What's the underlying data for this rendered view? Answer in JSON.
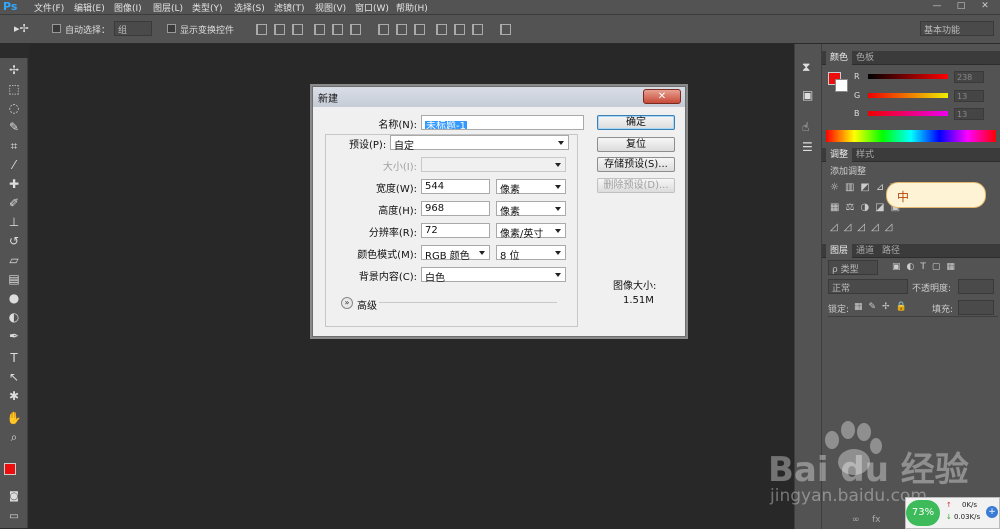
{
  "app": {
    "logo": "Ps"
  },
  "menu": [
    "文件(F)",
    "编辑(E)",
    "图像(I)",
    "图层(L)",
    "类型(Y)",
    "选择(S)",
    "滤镜(T)",
    "视图(V)",
    "窗口(W)",
    "帮助(H)"
  ],
  "window_controls": [
    "—",
    "□",
    "✕"
  ],
  "options": {
    "auto_select_label": "自动选择：",
    "auto_select_value": "组",
    "show_transform_label": "显示变换控件",
    "workspace": "基本功能"
  },
  "panels": {
    "color_tabs": [
      "颜色",
      "色板"
    ],
    "rgb": [
      {
        "label": "R",
        "value": "238"
      },
      {
        "label": "G",
        "value": "13"
      },
      {
        "label": "B",
        "value": "13"
      }
    ],
    "adjust_tabs": [
      "调整",
      "样式"
    ],
    "add_adjustment": "添加调整",
    "layers_tabs": [
      "图层",
      "通道",
      "路径"
    ],
    "layer_kind": "ρ 类型",
    "blend_mode": "正常",
    "opacity_label": "不透明度:",
    "lock_label": "锁定:",
    "fill_label": "填充:",
    "fx_icon": "fx",
    "ime_text": "中"
  },
  "dialog": {
    "title": "新建",
    "close": "✕",
    "name_label": "名称(N):",
    "name_value": "未标题-1",
    "preset_label": "预设(P):",
    "preset_value": "自定",
    "size_label": "大小(I):",
    "width_label": "宽度(W):",
    "width_value": "544",
    "width_unit": "像素",
    "height_label": "高度(H):",
    "height_value": "968",
    "height_unit": "像素",
    "resolution_label": "分辨率(R):",
    "resolution_value": "72",
    "resolution_unit": "像素/英寸",
    "color_mode_label": "颜色模式(M):",
    "color_mode_value": "RGB 颜色",
    "bit_depth": "8 位",
    "background_label": "背景内容(C):",
    "background_value": "白色",
    "advanced": "高级",
    "buttons": {
      "ok": "确定",
      "reset": "复位",
      "save_preset": "存储预设(S)...",
      "delete_preset": "删除预设(D)..."
    },
    "image_size_label": "图像大小:",
    "image_size_value": "1.51M"
  },
  "watermark": {
    "brand": "Bai du 经验",
    "url": "jingyan.baidu.com"
  },
  "net_widget": {
    "percent": "73%",
    "up": "0K/s",
    "down": "0.03K/s"
  },
  "colors": {
    "foreground": "#ee0d0d",
    "background": "#ffffff",
    "arrow": "#e8453c"
  }
}
